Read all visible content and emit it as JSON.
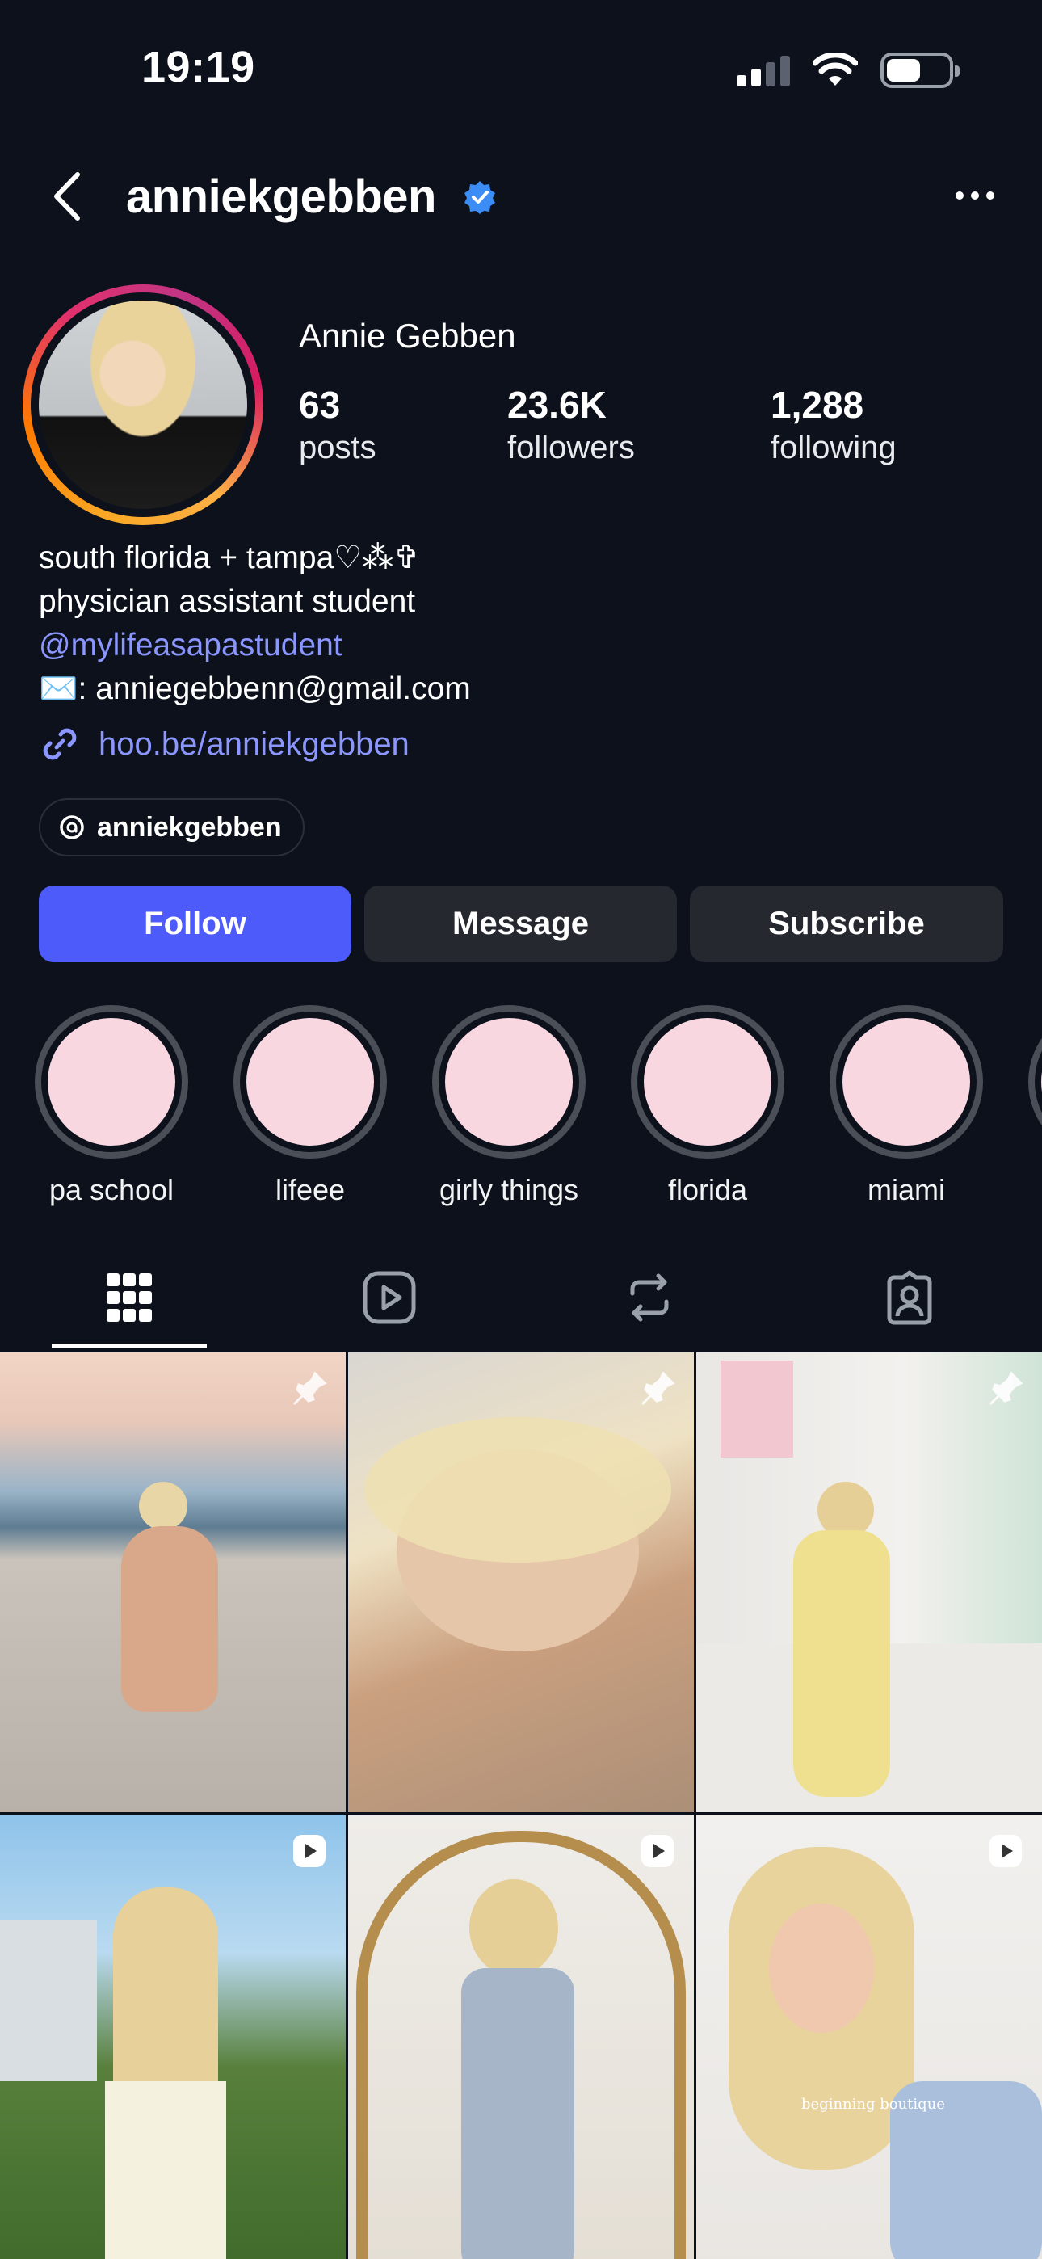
{
  "status_bar": {
    "time": "19:19",
    "signal_icon": "cellular-signal-icon",
    "wifi_icon": "wifi-icon",
    "battery_icon": "battery-icon",
    "battery_level": 0.55
  },
  "header": {
    "username": "anniekgebben",
    "verified": true,
    "back_icon": "chevron-left-icon",
    "more_icon": "more-horizontal-icon"
  },
  "profile": {
    "display_name": "Annie Gebben",
    "stats": [
      {
        "value": "63",
        "label": "posts"
      },
      {
        "value": "23.6K",
        "label": "followers"
      },
      {
        "value": "1,288",
        "label": "following"
      }
    ],
    "bio_lines": [
      "south florida + tampa♡⁂✞",
      "physician assistant student"
    ],
    "mention": "@mylifeasapastudent",
    "email_line": "✉️: anniegebbenn@gmail.com",
    "link": "hoo.be/anniekgebben",
    "threads_handle": "anniekgebben"
  },
  "buttons": {
    "follow": "Follow",
    "message": "Message",
    "subscribe": "Subscribe"
  },
  "highlights": [
    {
      "label": "pa school"
    },
    {
      "label": "lifeee"
    },
    {
      "label": "girly things"
    },
    {
      "label": "florida"
    },
    {
      "label": "miami"
    }
  ],
  "tabs": [
    {
      "icon": "grid-icon",
      "active": true
    },
    {
      "icon": "reels-icon",
      "active": false
    },
    {
      "icon": "reposts-icon",
      "active": false
    },
    {
      "icon": "tagged-icon",
      "active": false
    }
  ],
  "grid": [
    {
      "kind": "photo",
      "badge": "pin-icon"
    },
    {
      "kind": "photo",
      "badge": "pin-icon"
    },
    {
      "kind": "photo",
      "badge": "pin-icon"
    },
    {
      "kind": "reel",
      "badge": "reel-icon"
    },
    {
      "kind": "reel",
      "badge": "reel-icon"
    },
    {
      "kind": "reel",
      "badge": "reel-icon",
      "overlay_text": "beginning boutique"
    }
  ],
  "colors": {
    "background": "#0c111b",
    "follow_button": "#4c5bfa",
    "secondary_button": "#25282f",
    "link": "#8b96ff",
    "verified": "#3b8cf5"
  }
}
